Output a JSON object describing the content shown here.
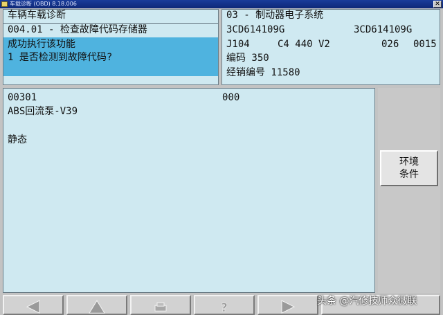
{
  "window": {
    "title": "车载诊断 (OBD) 8.18.006"
  },
  "header_left": {
    "title": "车辆车载诊断",
    "function": "004.01 - 检查故障代码存储器",
    "status": "成功执行该功能",
    "question": "1 是否检测到故障代码?"
  },
  "header_right": {
    "system": "03 - 制动器电子系统",
    "part_no_1": "3CD614109G",
    "part_no_2": "3CD614109G",
    "ecu_line_a": "J104",
    "ecu_line_b": "C4 440 V2",
    "ecu_line_c": "026",
    "ecu_line_d": "0015",
    "coding": "编码 350",
    "dealer": "经销编号 11580"
  },
  "main": {
    "fault_code": "00301",
    "fault_value": "000",
    "fault_desc": "ABS回流泵-V39",
    "fault_state": "静态"
  },
  "side": {
    "env_button_line1": "环境",
    "env_button_line2": "条件"
  },
  "toolbar": {
    "icons": [
      "arrow-left-icon",
      "arrow-up-icon",
      "print-icon",
      "help-icon",
      "arrow-right-icon"
    ]
  },
  "watermark": "头条 @汽修技师众微联",
  "colors": {
    "panel": "#cfe9f1",
    "highlight": "#4fb3df",
    "chrome": "#c3c3c3"
  }
}
